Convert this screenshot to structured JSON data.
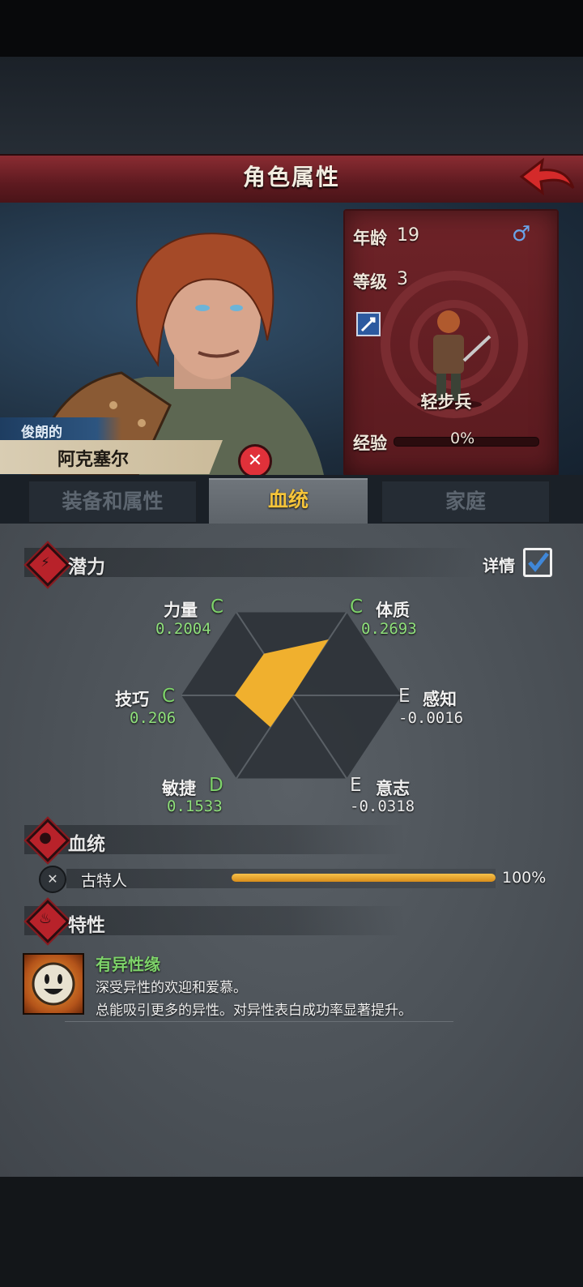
{
  "header": {
    "title": "角色属性"
  },
  "character": {
    "epithet": "俊朗的",
    "name": "阿克塞尔",
    "age_label": "年龄",
    "age_value": "19",
    "gender_symbol": "♂",
    "level_label": "等级",
    "level_value": "3",
    "class_name": "轻步兵",
    "exp_label": "经验",
    "exp_value": "0%",
    "exp_fraction": 0.0
  },
  "tabs": [
    {
      "label": "装备和属性",
      "active": false
    },
    {
      "label": "血统",
      "active": true
    },
    {
      "label": "家庭",
      "active": false
    }
  ],
  "potential": {
    "title": "潜力",
    "details_label": "详情",
    "details_checked": true,
    "stats": [
      {
        "name": "力量",
        "grade": "C",
        "value": "0.2004"
      },
      {
        "name": "体质",
        "grade": "C",
        "value": "0.2693"
      },
      {
        "name": "感知",
        "grade": "E",
        "value": "-0.0016"
      },
      {
        "name": "意志",
        "grade": "E",
        "value": "-0.0318"
      },
      {
        "name": "敏捷",
        "grade": "D",
        "value": "0.1533"
      },
      {
        "name": "技巧",
        "grade": "C",
        "value": "0.206"
      }
    ]
  },
  "bloodline": {
    "title": "血统",
    "entries": [
      {
        "name": "古特人",
        "percent": "100%",
        "fraction": 1.0
      }
    ]
  },
  "traits": {
    "title": "特性",
    "items": [
      {
        "name": "有异性缘",
        "line1": "深受异性的欢迎和爱慕。",
        "line2": "总能吸引更多的异性。对异性表白成功率显著提升。"
      }
    ]
  },
  "colors": {
    "grade_green": "#7ed36a",
    "radar_fill": "#f0b02e",
    "title_red": "#6e2328",
    "active_tab_text": "#f4c43a"
  }
}
